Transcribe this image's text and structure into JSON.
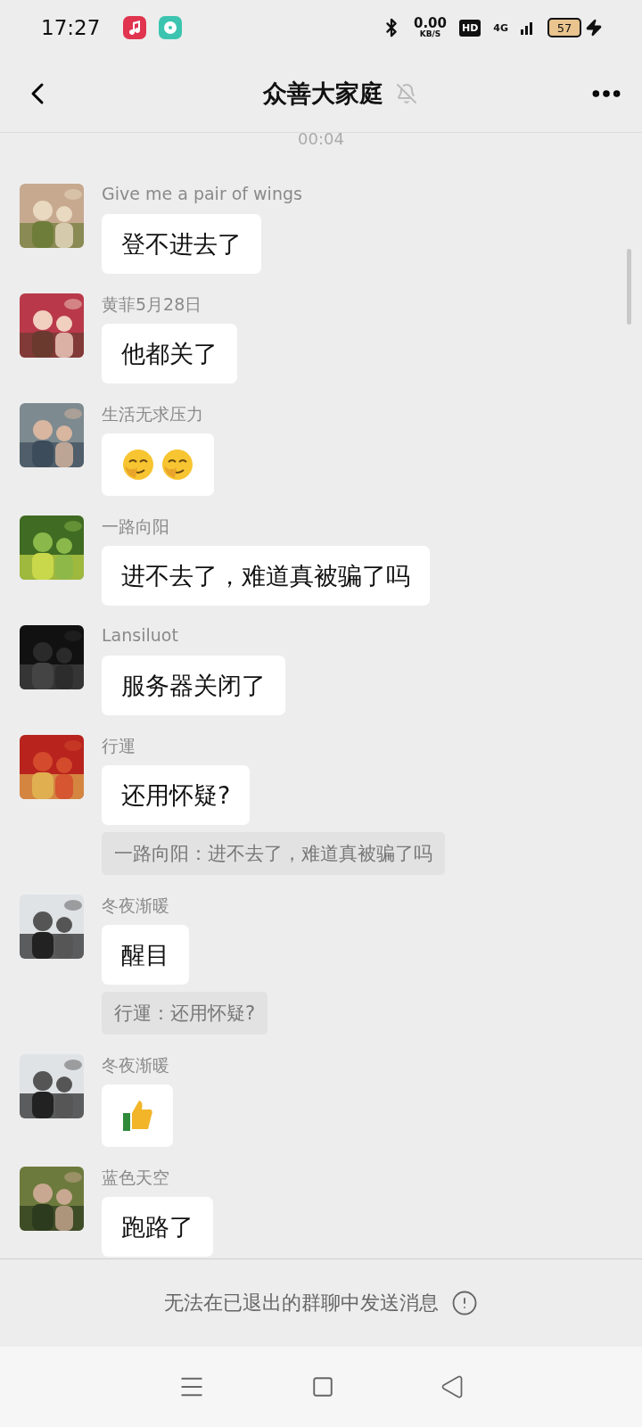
{
  "status_bar": {
    "time": "17:27",
    "net_speed": "0.00",
    "net_unit": "KB/S",
    "hd": "HD",
    "network": "4G",
    "battery": "57"
  },
  "header": {
    "title": "众善大家庭",
    "muted": true
  },
  "timestamp": "00:04",
  "messages": [
    {
      "sender": "Give me a pair of wings",
      "kind": "text",
      "text": "登不进去了"
    },
    {
      "sender": "黄菲5月28日",
      "kind": "text",
      "text": "他都关了"
    },
    {
      "sender": "生活无求压力",
      "kind": "emoji",
      "stickers": [
        {
          "kind": "facepalm"
        },
        {
          "kind": "facepalm"
        }
      ]
    },
    {
      "sender": "一路向阳",
      "kind": "text",
      "text": "进不去了，难道真被骗了吗"
    },
    {
      "sender": "Lansiluot",
      "kind": "text",
      "text": "服务器关闭了"
    },
    {
      "sender": "行運",
      "kind": "text",
      "text": "还用怀疑?",
      "quote": "一路向阳：进不去了，难道真被骗了吗"
    },
    {
      "sender": "冬夜渐暖",
      "kind": "text",
      "text": "醒目",
      "quote": "行運：还用怀疑?"
    },
    {
      "sender": "冬夜渐暖",
      "kind": "emoji",
      "stickers": [
        {
          "kind": "thumbs_up"
        }
      ]
    },
    {
      "sender": "蓝色天空",
      "kind": "text",
      "text": "跑路了"
    }
  ],
  "notice": "无法在已退出的群聊中发送消息"
}
